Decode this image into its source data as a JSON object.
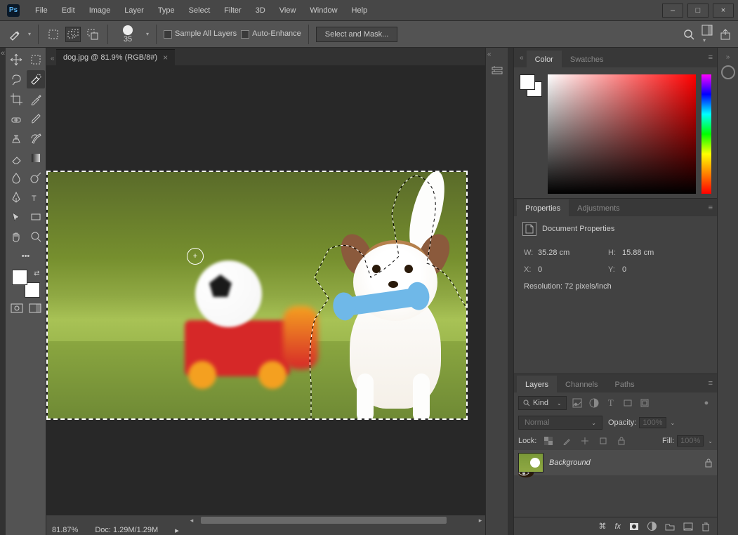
{
  "app": {
    "icon_text": "Ps"
  },
  "menubar": [
    "File",
    "Edit",
    "Image",
    "Layer",
    "Type",
    "Select",
    "Filter",
    "3D",
    "View",
    "Window",
    "Help"
  ],
  "optbar": {
    "brush_size": "35",
    "sample_all": "Sample All Layers",
    "auto_enhance": "Auto-Enhance",
    "select_mask": "Select and Mask..."
  },
  "tab": {
    "title": "dog.jpg @ 81.9% (RGB/8#)",
    "close": "×"
  },
  "status": {
    "zoom": "81.87%",
    "doc": "Doc: 1.29M/1.29M"
  },
  "cursor_symbol": "+",
  "panels": {
    "color": {
      "tab1": "Color",
      "tab2": "Swatches"
    },
    "props": {
      "tab1": "Properties",
      "tab2": "Adjustments",
      "header": "Document Properties",
      "w_lbl": "W:",
      "w": "35.28 cm",
      "h_lbl": "H:",
      "h": "15.88 cm",
      "x_lbl": "X:",
      "x": "0",
      "y_lbl": "Y:",
      "y": "0",
      "res": "Resolution: 72 pixels/inch"
    },
    "layers": {
      "tab1": "Layers",
      "tab2": "Channels",
      "tab3": "Paths",
      "kind_lbl": "Kind",
      "blend": "Normal",
      "opacity_lbl": "Opacity:",
      "opacity_val": "100%",
      "lock_lbl": "Lock:",
      "fill_lbl": "Fill:",
      "fill_val": "100%",
      "bg": "Background"
    }
  }
}
